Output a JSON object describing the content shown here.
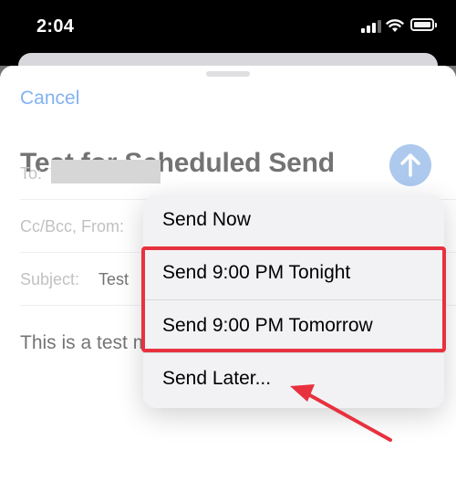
{
  "status_bar": {
    "time": "2:04"
  },
  "compose": {
    "cancel_label": "Cancel",
    "subject_title": "Test for Scheduled Send",
    "to_label": "To:",
    "cc_label": "Cc/Bcc, From:",
    "subject_label": "Subject:",
    "subject_value": "Test",
    "body": "This is a test message."
  },
  "send_menu": {
    "items": [
      {
        "label": "Send Now"
      },
      {
        "label": "Send 9:00 PM Tonight"
      },
      {
        "label": "Send 9:00 PM Tomorrow"
      },
      {
        "label": "Send Later..."
      }
    ]
  },
  "annotation": {
    "highlight_color": "#e8313e",
    "arrow_color": "#e8313e"
  },
  "colors": {
    "accent": "#1a73e8",
    "send_button": "#6a9ee0"
  }
}
